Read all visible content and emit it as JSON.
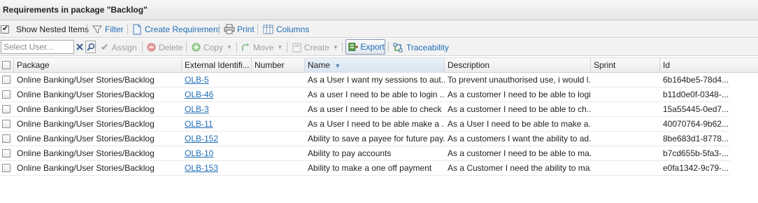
{
  "title": "Requirements in package \"Backlog\"",
  "toolbar1": {
    "show_nested_label": "Show Nested Items",
    "filter_label": "Filter",
    "create_requirement_label": "Create Requirement",
    "print_label": "Print",
    "columns_label": "Columns"
  },
  "toolbar2": {
    "user_placeholder": "Select User...",
    "assign_label": "Assign",
    "delete_label": "Delete",
    "copy_label": "Copy",
    "move_label": "Move",
    "create_label": "Create",
    "export_label": "Export",
    "traceability_label": "Traceability"
  },
  "columns": {
    "package": "Package",
    "external_id": "External Identifi...",
    "number": "Number",
    "name": "Name",
    "description": "Description",
    "sprint": "Sprint",
    "id": "Id"
  },
  "rows": [
    {
      "package": "Online Banking/User Stories/Backlog",
      "external_id": "OLB-5",
      "number": "",
      "name": "As a User I want my sessions to aut...",
      "description": "To prevent unauthorised use, i would l...",
      "sprint": "",
      "id": "6b164be5-78d4..."
    },
    {
      "package": "Online Banking/User Stories/Backlog",
      "external_id": "OLB-46",
      "number": "",
      "name": "As a user I need to be able to login ...",
      "description": "As a customer I need to be able to logi...",
      "sprint": "",
      "id": "b11d0e0f-0348-..."
    },
    {
      "package": "Online Banking/User Stories/Backlog",
      "external_id": "OLB-3",
      "number": "",
      "name": "As a user I need to be able to check ...",
      "description": "As a customer I need to be able to ch...",
      "sprint": "",
      "id": "15a55445-0ed7..."
    },
    {
      "package": "Online Banking/User Stories/Backlog",
      "external_id": "OLB-11",
      "number": "",
      "name": "As a User I need to be able make a ...",
      "description": "As a User I need to be able to make a...",
      "sprint": "",
      "id": "40070764-9b62..."
    },
    {
      "package": "Online Banking/User Stories/Backlog",
      "external_id": "OLB-152",
      "number": "",
      "name": "Ability to save a payee for future pay...",
      "description": "As a customers I want the ability to ad...",
      "sprint": "",
      "id": "8be683d1-8778..."
    },
    {
      "package": "Online Banking/User Stories/Backlog",
      "external_id": "OLB-10",
      "number": "",
      "name": "Ability to pay accounts",
      "description": "As a customer I need to be able to ma...",
      "sprint": "",
      "id": "b7cd655b-5fa3-..."
    },
    {
      "package": "Online Banking/User Stories/Backlog",
      "external_id": "OLB-153",
      "number": "",
      "name": "Ability to make a one off payment",
      "description": "As a Customer I need the ability to ma...",
      "sprint": "",
      "id": "e0fa1342-9c79-..."
    }
  ],
  "icons": [
    "checkbox-checked-icon",
    "filter-icon",
    "document-icon",
    "printer-icon",
    "columns-icon",
    "clear-icon",
    "search-icon",
    "check-icon",
    "delete-icon",
    "copy-icon",
    "move-icon",
    "create-icon",
    "export-icon",
    "traceability-icon",
    "sort-down-icon"
  ],
  "colors": {
    "link": "#1f6db5",
    "disabled": "#a0a0a0",
    "header_bg": "#ececec"
  }
}
